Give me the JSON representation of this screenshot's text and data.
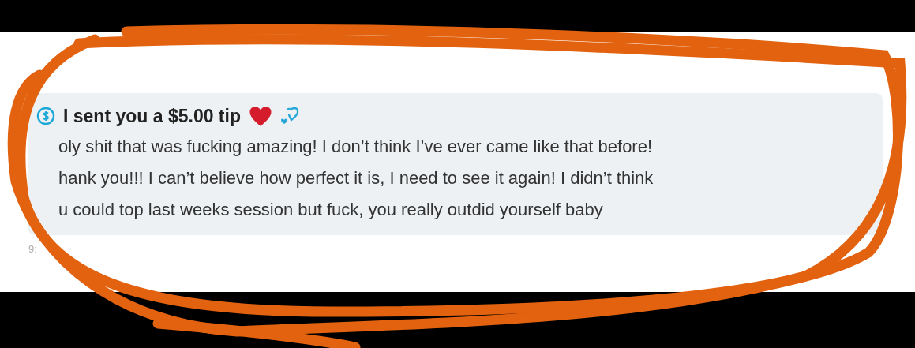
{
  "message": {
    "title": "I sent you a $5.00 tip",
    "lines": [
      "oly shit that was fucking amazing! I don’t think I’ve ever came like that before!",
      "hank you!!! I can’t believe how perfect it is, I need to see it again! I didn’t think",
      "u could top last weeks session but fuck, you really outdid yourself baby"
    ],
    "time": "9:"
  }
}
